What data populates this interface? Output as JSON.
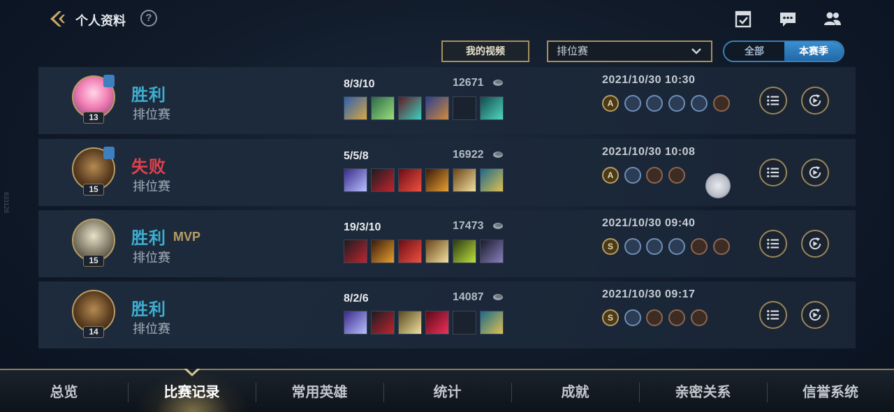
{
  "header": {
    "title": "个人资料",
    "help": "?"
  },
  "filters": {
    "video_label": "我的视频",
    "mode_value": "排位赛",
    "toggle": {
      "all": "全部",
      "season": "本赛季",
      "selected": "season"
    }
  },
  "matches": [
    {
      "result": "胜利",
      "mvp": "",
      "mode": "排位赛",
      "kda": "8/3/10",
      "gold": "12671",
      "level": "13",
      "datetime": "2021/10/30 10:30"
    },
    {
      "result": "失败",
      "mvp": "",
      "mode": "排位赛",
      "kda": "5/5/8",
      "gold": "16922",
      "level": "15",
      "datetime": "2021/10/30 10:08"
    },
    {
      "result": "胜利",
      "mvp": "MVP",
      "mode": "排位赛",
      "kda": "19/3/10",
      "gold": "17473",
      "level": "15",
      "datetime": "2021/10/30 09:40"
    },
    {
      "result": "胜利",
      "mvp": "",
      "mode": "排位赛",
      "kda": "8/2/6",
      "gold": "14087",
      "level": "14",
      "datetime": "2021/10/30 09:17"
    }
  ],
  "badge_letters": {
    "m0": "A",
    "m1": "A",
    "m2": "S",
    "m3": "S"
  },
  "side_tag": "833128",
  "bottom_nav": [
    "总览",
    "比赛记录",
    "常用英雄",
    "统计",
    "成就",
    "亲密关系",
    "信誉系统"
  ],
  "colors": {
    "win": "#3eaecf",
    "lose": "#e0404a",
    "gold_border": "#b89d62",
    "accent_blue": "#3a8fd0"
  }
}
